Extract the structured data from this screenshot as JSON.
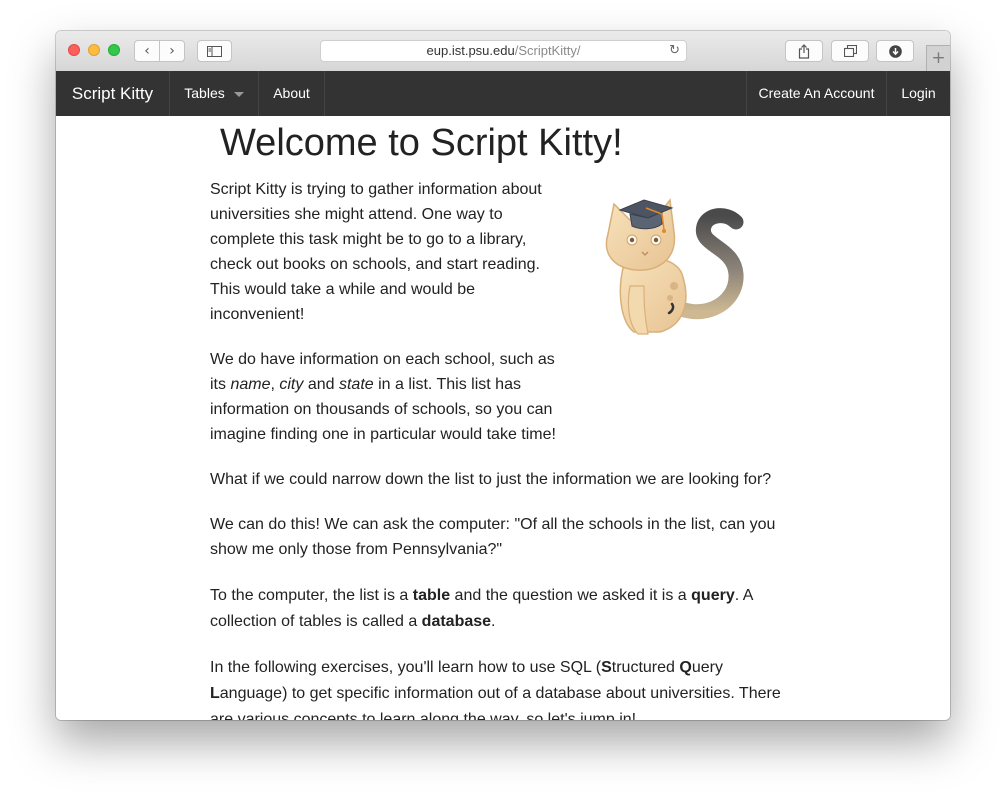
{
  "browser": {
    "url_host": "eup.ist.psu.edu",
    "url_path": "/ScriptKitty/",
    "reload_icon": "reload-icon",
    "back_icon": "chevron-left-icon",
    "forward_icon": "chevron-right-icon",
    "sidebar_icon": "sidebar-icon",
    "share_icon": "share-icon",
    "tabs_icon": "tabs-icon",
    "downloads_icon": "download-icon",
    "newtab_label": "+"
  },
  "nav": {
    "brand": "Script Kitty",
    "tables": "Tables",
    "about": "About",
    "create_account": "Create An Account",
    "login": "Login"
  },
  "main": {
    "title": "Welcome to Script Kitty!",
    "p1": "Script Kitty is trying to gather information about universities she might attend. One way to complete this task might be to go to a library, check out books on schools, and start reading. This would take a while and would be inconvenient!",
    "p2_a": "We do have information on each school, such as its ",
    "p2_name": "name",
    "p2_comma": ", ",
    "p2_city": "city",
    "p2_and": " and ",
    "p2_state": "state",
    "p2_b": " in a list. This list has information on thousands of schools, so you can imagine finding one in particular would take time!",
    "p3": "What if we could narrow down the list to just the information we are looking for?",
    "p4": "We can do this! We can ask the computer: \"Of all the schools in the list, can you show me only those from Pennsylvania?\"",
    "p5_a": "To the computer, the list is a ",
    "p5_table": "table",
    "p5_b": " and the question we asked it is a ",
    "p5_query": "query",
    "p5_c": ". A collection of tables is called a ",
    "p5_database": "database",
    "p5_d": ".",
    "p6_a": "In the following exercises, you'll learn how to use SQL (",
    "p6_S": "S",
    "p6_b": "tructured ",
    "p6_Q": "Q",
    "p6_c": "uery ",
    "p6_L": "L",
    "p6_d": "anguage) to get specific information out of a database about universities. There are various concepts to learn along the way, so let's jump in!"
  },
  "colors": {
    "navbar": "#333333",
    "text": "#222222"
  }
}
